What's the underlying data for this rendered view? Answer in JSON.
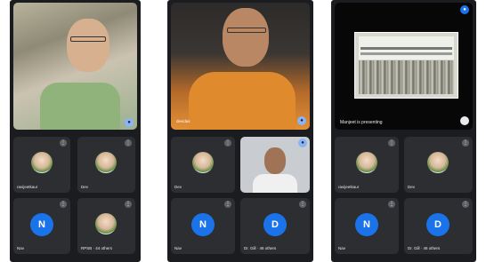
{
  "phones": [
    {
      "main_name": "",
      "tiles": [
        {
          "name": "ravijeetkaur",
          "avatar": "photo"
        },
        {
          "name": "Dev",
          "avatar": "photo"
        },
        {
          "name": "Nav",
          "avatar": "letter",
          "letter": "N"
        },
        {
          "name": "RPSB · 44 others",
          "avatar": "photo"
        }
      ]
    },
    {
      "main_name": "devidas",
      "tiles": [
        {
          "name": "Dev",
          "avatar": "photo"
        },
        {
          "name": "",
          "avatar": "video"
        },
        {
          "name": "Nav",
          "avatar": "letter",
          "letter": "N"
        },
        {
          "name": "Dr. Gill · 46 others",
          "avatar": "letter",
          "letter": "D"
        }
      ]
    },
    {
      "presenting_text": "Manjeet is presenting",
      "tiles": [
        {
          "name": "ravijeetkaur",
          "avatar": "photo"
        },
        {
          "name": "Dev",
          "avatar": "photo"
        },
        {
          "name": "Nav",
          "avatar": "letter",
          "letter": "N"
        },
        {
          "name": "Dr. Gill · 46 others",
          "avatar": "letter",
          "letter": "D"
        }
      ]
    }
  ],
  "icons": {
    "more": "more-vert-icon",
    "mic": "mic-icon",
    "blue": "#1a73e8",
    "tile_bg": "#2d2e31"
  }
}
